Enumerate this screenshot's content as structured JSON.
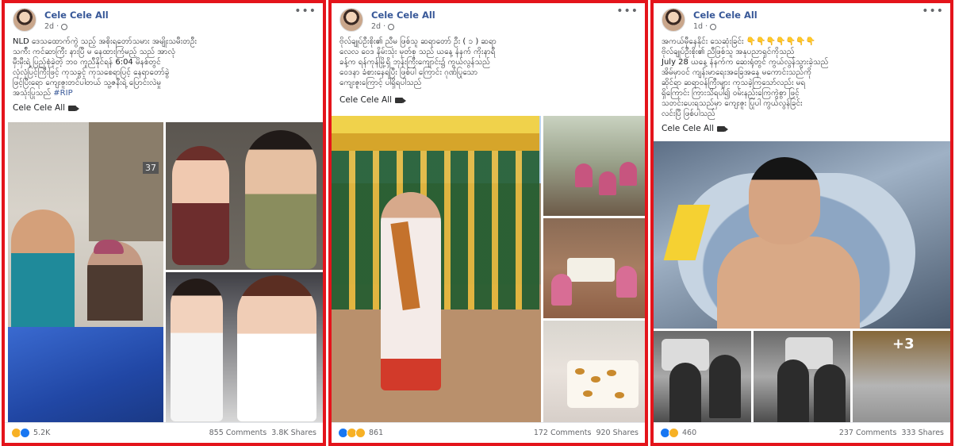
{
  "posts": [
    {
      "author": "Cele Cele All",
      "time": "2d",
      "more": "•••",
      "text": "NLD ဒေသထောက်ကွဲ သည့် အစိုးရတော်သမား အမျိုးသမီးတဦး\nသက်ီး ကင်ဆာကြီး နားပြီ မ နေထားကြံမည့် သည် အာလုံ\nမှီးမှီးရဲ့ ပြည့်စုံခဲ့တဲ့ ဘ၀ ကူညီနိုင်ရန် 6:04 မိနစ်တွင်\nလုံလုံပြင့်ကြီးဖြင့် ကုသခွင့် ကုသစေရာပြင့် နေရာတော်ခွဲ\nဖြင့်ပြီးရော ကျေးဇူးတင်ပါတယ် သူ့ဇနီးရဲ့ ပြောင်းလဲမှု\nအသုံးပြုသည်",
      "hashtag": "#RIP",
      "signature": "Cele Cele All",
      "reaction_count": "5.2K",
      "comments": "855 Comments",
      "shares": "3.8K Shares"
    },
    {
      "author": "Cele Cele All",
      "time": "2d",
      "more": "•••",
      "text": "ဗိုလ်ချုပ်ဦးစိုး၏ ညီမ ဖြစ်သူ ဆရာတော် ဦး ( ၁ ) ဆရာ\nလေလ ဝေဒ နိမ်းသုံး မှတ်စု သည် ယနေ့ နံနက် ကိုးနာရီ\nခန့်က ရန်ကုန်မြို့ရှိ ဘုန်းကြီးကျောင်း၌ ကွယ်လွန်သည်\nဝေဒနာ ခံစားနေရပြီး ဖြစ်ပါ ကြောင်း ဂုဏ်ပြုသော\nကျေးဇူးကြောင့် ပါရှိရပါသည်",
      "signature": "Cele Cele All",
      "reaction_count": "861",
      "comments": "172 Comments",
      "shares": "920 Shares"
    },
    {
      "author": "Cele Cele All",
      "time": "1d",
      "more": "•••",
      "text": "အကယ်မှီနေနိုင်း သေဆုံးခြင်း 👇👇👇👇👇👇👇\nဗိုလ်ချုပ်ဦးစိုး၏ ညီဖြစ်သူ အနုပညာရှင်ကိုသည်\nJuly 28 ယနေ့ နံနက်က ဆေးရုံတွင် ကွယ်လွန်သွားခဲ့သည်\nအိမ်မှာဝင် ကျန်းမာရေးအခြေအနေ မကောင်းသည်ကို\nဆိုင်ရာ ဆရာဝန်ကြီးများ ကုသခဲ့ကြသော်လည်း မရ\nရှိကြောင်း ကြားသိရပါ၍ ဝမ်းနည်းကြေကွဲစွာ ဖြင့်\nသတင်းပေးရသည်မှာ ကျေးဇူး ပြုပါ ကွယ်လွန်ခြင်း\nလင်းပြီ ဖြစ်ပါသည်",
      "signature": "Cele Cele All",
      "reaction_count": "460",
      "comments": "237 Comments",
      "shares": "333 Shares",
      "more_photos": "+3"
    }
  ]
}
